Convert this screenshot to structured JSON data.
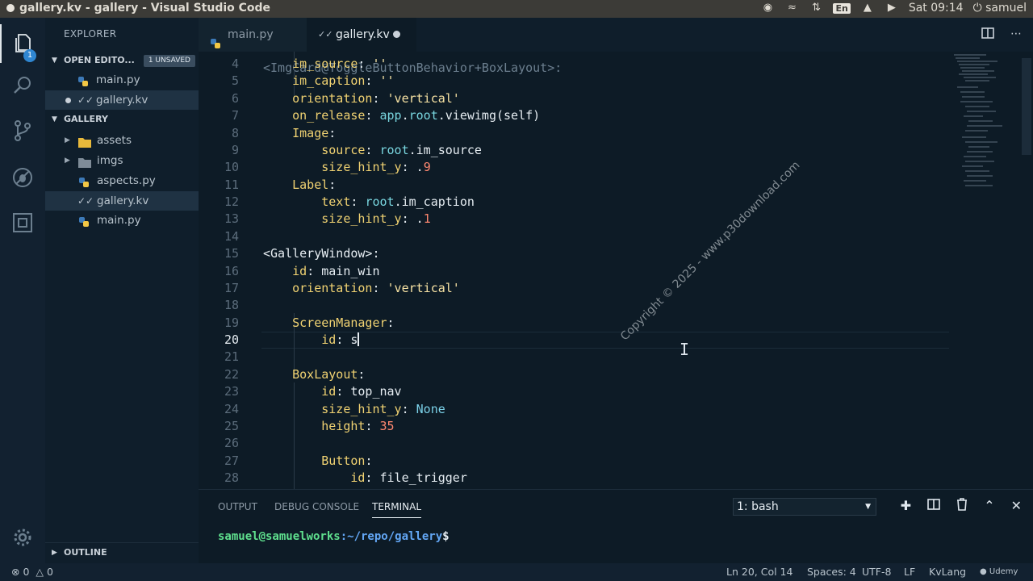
{
  "window_title": "gallery.kv - gallery - Visual Studio Code",
  "system_tray": {
    "language": "En",
    "time": "Sat 09:14",
    "user": "samuel"
  },
  "activity_bar": {
    "explorer_badge": "1"
  },
  "sidebar": {
    "title": "EXPLORER",
    "open_editors": {
      "label": "OPEN EDITO...",
      "badge": "1 UNSAVED",
      "files": [
        "main.py",
        "gallery.kv"
      ]
    },
    "gallery": {
      "label": "GALLERY",
      "items": [
        "assets",
        "imgs",
        "aspects.py",
        "gallery.kv",
        "main.py"
      ]
    },
    "outline_label": "OUTLINE"
  },
  "tabs": [
    {
      "label": "main.py"
    },
    {
      "label": "gallery.kv"
    }
  ],
  "editor": {
    "lines": [
      {
        "num": "4",
        "text": "    im_source: ''"
      },
      {
        "num": "5",
        "text": "    im_caption: ''"
      },
      {
        "num": "6",
        "text": "    orientation: 'vertical'"
      },
      {
        "num": "7",
        "text": "    on_release: app.root.viewimg(self)"
      },
      {
        "num": "8",
        "text": "    Image:"
      },
      {
        "num": "9",
        "text": "        source: root.im_source"
      },
      {
        "num": "10",
        "text": "        size_hint_y: .9"
      },
      {
        "num": "11",
        "text": "    Label:"
      },
      {
        "num": "12",
        "text": "        text: root.im_caption"
      },
      {
        "num": "13",
        "text": "        size_hint_y: .1"
      },
      {
        "num": "14",
        "text": ""
      },
      {
        "num": "15",
        "text": "<GalleryWindow>:"
      },
      {
        "num": "16",
        "text": "    id: main_win"
      },
      {
        "num": "17",
        "text": "    orientation: 'vertical'"
      },
      {
        "num": "18",
        "text": ""
      },
      {
        "num": "19",
        "text": "    ScreenManager:"
      },
      {
        "num": "20",
        "text": "        id: s"
      },
      {
        "num": "21",
        "text": ""
      },
      {
        "num": "22",
        "text": "    BoxLayout:"
      },
      {
        "num": "23",
        "text": "        id: top_nav"
      },
      {
        "num": "24",
        "text": "        size_hint_y: None"
      },
      {
        "num": "25",
        "text": "        height: 35"
      },
      {
        "num": "26",
        "text": ""
      },
      {
        "num": "27",
        "text": "        Button:"
      },
      {
        "num": "28",
        "text": "            id: file_trigger"
      }
    ],
    "watermark": "Copyright © 2025 - www.p30download.com"
  },
  "panel": {
    "tabs": [
      "OUTPUT",
      "DEBUG CONSOLE",
      "TERMINAL"
    ],
    "active_tab": "TERMINAL",
    "terminal_select": "1: bash",
    "prompt_user": "samuel@samuelworks",
    "prompt_path": ":~/repo/gallery",
    "prompt_symbol": "$"
  },
  "status_bar": {
    "errors": "0",
    "warnings": "0",
    "position": "Ln 20, Col 14",
    "spaces": "Spaces: 4",
    "encoding": "UTF-8",
    "eol": "LF",
    "language": "KvLang",
    "udemy": "Udemy"
  },
  "colors": {
    "accent": "#2f86d1",
    "keyword": "#f0d272",
    "string": "#f8e3a4",
    "number": "#ff8870"
  }
}
